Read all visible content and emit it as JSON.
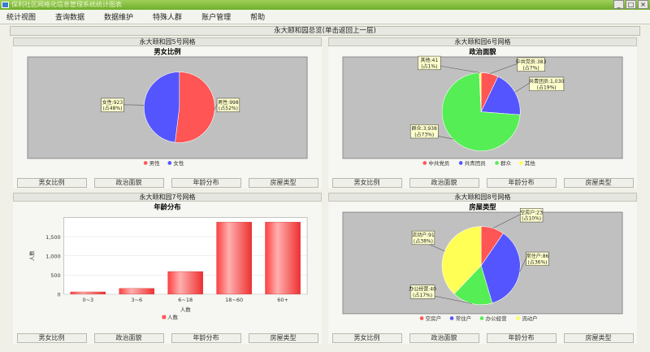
{
  "window": {
    "title": "保利社区网格化信息管理系统统计图表"
  },
  "menu": {
    "items": [
      "统计视图",
      "查询数据",
      "数据维护",
      "特殊人群",
      "账户管理",
      "帮助"
    ]
  },
  "overview": {
    "title": "永大颐和园总览(单击返回上一层)"
  },
  "tab_labels": [
    "男女比例",
    "政治面貌",
    "年龄分布",
    "房屋类型"
  ],
  "panels": [
    {
      "grid_title": "永大颐和园5号网格",
      "chart_title": "男女比例"
    },
    {
      "grid_title": "永大颐和园6号网格",
      "chart_title": "政治面貌"
    },
    {
      "grid_title": "永大颐和园7号网格",
      "chart_title": "年龄分布"
    },
    {
      "grid_title": "永大颐和园8号网格",
      "chart_title": "房屋类型"
    }
  ],
  "chart_data": [
    {
      "type": "pie",
      "title": "男女比例",
      "categories": [
        "男性",
        "女性"
      ],
      "values": [
        998,
        923
      ],
      "percent_labels": [
        "占52%",
        "占48%"
      ],
      "colors": [
        "#ff5555",
        "#5555ff"
      ],
      "legend": "bottom"
    },
    {
      "type": "pie",
      "title": "政治面貌",
      "categories": [
        "中共党员",
        "共青团员",
        "群众",
        "其他"
      ],
      "values": [
        383,
        1030,
        3938,
        41
      ],
      "percent_labels": [
        "占7%",
        "占19%",
        "占73%",
        "占1%"
      ],
      "colors": [
        "#ff5555",
        "#5555ff",
        "#55ee55",
        "#ffff55"
      ],
      "legend": "bottom"
    },
    {
      "type": "bar",
      "title": "年龄分布",
      "categories": [
        "0~3",
        "3~6",
        "6~18",
        "18~60",
        "60+"
      ],
      "series": [
        {
          "name": "人数",
          "values": [
            60,
            150,
            590,
            1880,
            1880
          ]
        }
      ],
      "xlabel": "人数",
      "ylabel": "人数",
      "ylim": [
        0,
        2000
      ],
      "yticks": [
        0,
        500,
        1000,
        1500
      ],
      "ytick_labels": [
        "0",
        "500",
        "1,000",
        "1,500"
      ],
      "colors": [
        "#ff5555"
      ],
      "legend": "bottom"
    },
    {
      "type": "pie",
      "title": "房屋类型",
      "categories": [
        "空房户",
        "常住户",
        "办公经营",
        "流动户"
      ],
      "values": [
        23,
        86,
        40,
        91
      ],
      "percent_labels": [
        "占10%",
        "占36%",
        "占17%",
        "占38%"
      ],
      "colors": [
        "#ff5555",
        "#5555ff",
        "#55ee55",
        "#ffff55"
      ],
      "legend": "bottom"
    }
  ]
}
